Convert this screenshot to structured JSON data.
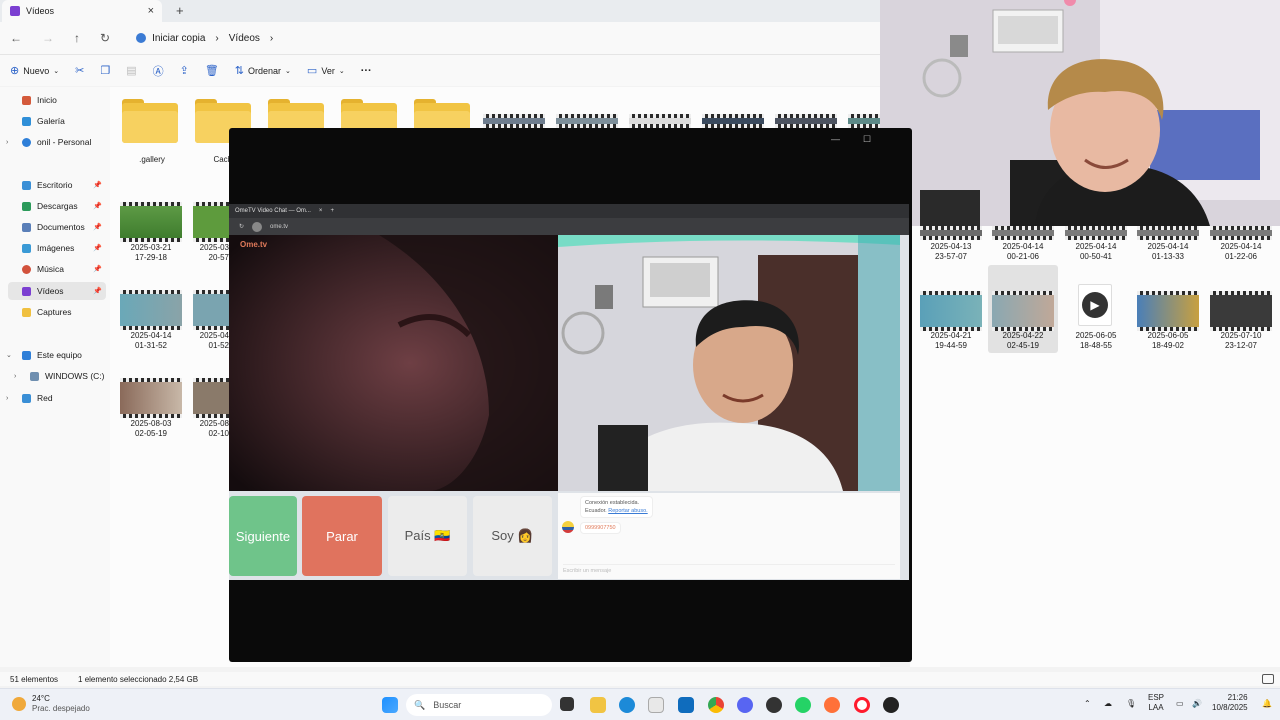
{
  "explorer": {
    "tab_title": "Vídeos",
    "breadcrumb": {
      "home": "Iniciar copia",
      "current": "Vídeos"
    },
    "toolbar": {
      "new": "Nuevo",
      "sort": "Ordenar",
      "view": "Ver",
      "more": "···"
    },
    "sidebar": [
      "Inicio",
      "Galería",
      "onil - Personal",
      "Escritorio",
      "Descargas",
      "Documentos",
      "Imágenes",
      "Música",
      "Vídeos",
      "Captures",
      "Este equipo",
      "WINDOWS (C:)",
      "Red"
    ],
    "folders": [
      ".gallery",
      "Cache"
    ],
    "left_items": [
      {
        "date": "2025-03-21",
        "time": "17-29-18"
      },
      {
        "date": "2025-03",
        "time": "20-57"
      },
      {
        "date": "2025-04-14",
        "time": "01-31-52"
      },
      {
        "date": "2025-04",
        "time": "01-52"
      },
      {
        "date": "2025-08-03",
        "time": "02-05-19"
      },
      {
        "date": "2025-08",
        "time": "02-10"
      }
    ],
    "right_row1": [
      {
        "date": "2025-04-13",
        "time": "23-57-07"
      },
      {
        "date": "2025-04-14",
        "time": "00-21-06"
      },
      {
        "date": "2025-04-14",
        "time": "00-50-41"
      },
      {
        "date": "2025-04-14",
        "time": "01-13-33"
      },
      {
        "date": "2025-04-14",
        "time": "01-22-06"
      }
    ],
    "right_row2": [
      {
        "date": "2025-04-21",
        "time": "19-44-59"
      },
      {
        "date": "2025-04-22",
        "time": "02-45-19"
      },
      {
        "date": "2025-06-05",
        "time": "18-48-55"
      },
      {
        "date": "2025-06-05",
        "time": "18-49-02"
      },
      {
        "date": "2025-07-10",
        "time": "23-12-07"
      }
    ],
    "status": {
      "count": "51 elementos",
      "selected": "1 elemento seleccionado  2,54 GB"
    }
  },
  "ome": {
    "browser_tab": "OmeTV Video Chat — Om...",
    "url": "ome.tv",
    "logo": "Ome.tv",
    "buttons": {
      "next": "Siguiente",
      "stop": "Parar",
      "country": "País 🇪🇨",
      "gender": "Soy 👩"
    },
    "chat": {
      "connected": "Conexión establecida.",
      "location": "Ecuador.",
      "location_link": "Reportar abuso.",
      "message": "0999907750",
      "input_placeholder": "Escribir un mensaje"
    }
  },
  "taskbar": {
    "weather_temp": "24°C",
    "weather_desc": "Prac. despejado",
    "search": "Buscar",
    "lang": "ESP",
    "layout": "LAA",
    "time": "21:26",
    "date": "10/8/2025"
  },
  "colors": {
    "next_btn": "#6fc48a",
    "stop_btn": "#e0735e",
    "accent": "#7b3fd1"
  }
}
